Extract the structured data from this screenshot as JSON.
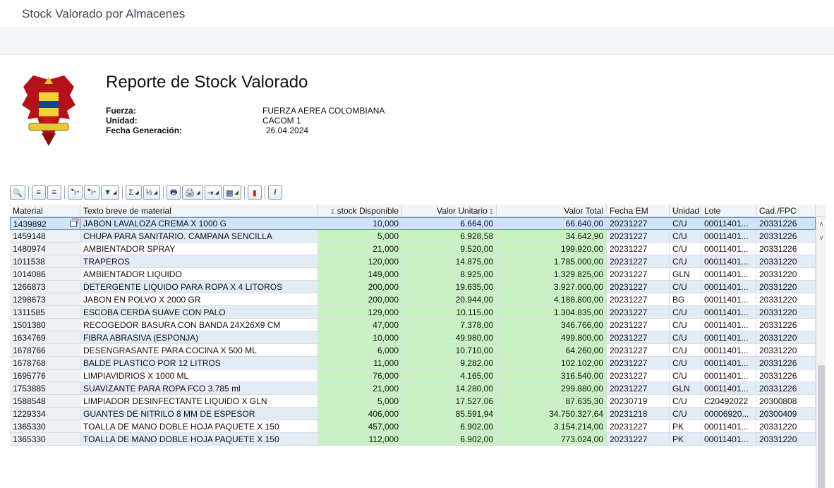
{
  "window": {
    "title": "Stock Valorado por Almacenes"
  },
  "report": {
    "title": "Reporte de Stock Valorado",
    "fields": [
      {
        "label": "Fuerza:",
        "value": "FUERZA AEREA COLOMBIANA"
      },
      {
        "label": "Unidad:",
        "value": "CACOM 1"
      },
      {
        "label": "Fecha Generación:",
        "value": "26.04.2024"
      }
    ]
  },
  "toolbar": {
    "buttons": [
      {
        "name": "details-icon",
        "glyph": "🔍"
      },
      {
        "name": "sort-ascending-icon",
        "glyph": "≡"
      },
      {
        "name": "sort-descending-icon",
        "glyph": "≡"
      },
      {
        "name": "find-icon",
        "glyph": "🔭"
      },
      {
        "name": "find-next-icon",
        "glyph": "🔭"
      },
      {
        "name": "filter-icon",
        "glyph": "▼"
      },
      {
        "name": "sum-icon",
        "glyph": "Σ"
      },
      {
        "name": "subtotal-icon",
        "glyph": "½"
      },
      {
        "name": "print-icon",
        "glyph": "🖶"
      },
      {
        "name": "print-preview-icon",
        "glyph": "🖨"
      },
      {
        "name": "export-icon",
        "glyph": "⇥"
      },
      {
        "name": "layout-icon",
        "glyph": "▦"
      },
      {
        "name": "graphic-icon",
        "glyph": "▮"
      },
      {
        "name": "info-icon",
        "glyph": "i"
      }
    ]
  },
  "table": {
    "columns": [
      "Material",
      "Texto breve de material",
      "stock Disponible",
      "Valor Unitario",
      "Valor Total",
      "Fecha EM",
      "Unidad",
      "Lote",
      "Cad./FPC"
    ],
    "sum_marker": "Σ",
    "rows": [
      [
        "1439892",
        "JABON LAVALOZA CREMA X 1000 G",
        "10,000",
        "6.664,00",
        "66.640,00",
        "20231227",
        "C/U",
        "00011401...",
        "20331226"
      ],
      [
        "1459148",
        "CHUPA  PARA SANITARIO. CAMPANA SENCILLA",
        "5,000",
        "6.928,58",
        "34.642,90",
        "20231227",
        "C/U",
        "00011401...",
        "20331226"
      ],
      [
        "1480974",
        "AMBIENTADOR SPRAY",
        "21,000",
        "9.520,00",
        "199.920,00",
        "20231227",
        "C/U",
        "00011401...",
        "20331226"
      ],
      [
        "1011538",
        "TRAPEROS",
        "120,000",
        "14.875,00",
        "1.785.000,00",
        "20231227",
        "C/U",
        "00011401...",
        "20331220"
      ],
      [
        "1014086",
        "AMBIENTADOR LIQUIDO",
        "149,000",
        "8.925,00",
        "1.329.825,00",
        "20231227",
        "GLN",
        "00011401...",
        "20331220"
      ],
      [
        "1266873",
        "DETERGENTE LIQUIDO PARA ROPA X 4 LITOROS",
        "200,000",
        "19.635,00",
        "3.927.000,00",
        "20231227",
        "C/U",
        "00011401...",
        "20331220"
      ],
      [
        "1298673",
        "JABON EN POLVO X 2000 GR",
        "200,000",
        "20.944,00",
        "4.188.800,00",
        "20231227",
        "BG",
        "00011401...",
        "20331220"
      ],
      [
        "1311585",
        "ESCOBA CERDA SUAVE CON PALO",
        "129,000",
        "10.115,00",
        "1.304.835,00",
        "20231227",
        "C/U",
        "00011401...",
        "20331220"
      ],
      [
        "1501380",
        "RECOGEDOR BASURA CON BANDA 24X26X9 CM",
        "47,000",
        "7.378,00",
        "346.766,00",
        "20231227",
        "C/U",
        "00011401...",
        "20331226"
      ],
      [
        "1634769",
        "FIBRA ABRASIVA (ESPONJA)",
        "10,000",
        "49.980,00",
        "499.800,00",
        "20231227",
        "C/U",
        "00011401...",
        "20331220"
      ],
      [
        "1678766",
        "DESENGRASANTE PARA COCINA X 500 ML",
        "6,000",
        "10.710,00",
        "64.260,00",
        "20231227",
        "C/U",
        "00011401...",
        "20331220"
      ],
      [
        "1678768",
        "BALDE PLASTICO POR 12 LITROS",
        "11,000",
        "9.282,00",
        "102.102,00",
        "20231227",
        "C/U",
        "00011401...",
        "20331226"
      ],
      [
        "1695776",
        "LIMPIAVIDRIOS X 1000 ML",
        "76,000",
        "4.165,00",
        "316.540,00",
        "20231227",
        "C/U",
        "00011401...",
        "20331226"
      ],
      [
        "1753885",
        "SUAVIZANTE PARA ROPA FCO 3.785 ml",
        "21,000",
        "14.280,00",
        "299.880,00",
        "20231227",
        "GLN",
        "00011401...",
        "20331226"
      ],
      [
        "1588548",
        "LIMPIADOR DESINFECTANTE LIQUIDO X GLN",
        "5,000",
        "17.527,06",
        "87.635,30",
        "20230719",
        "C/U",
        "C20492022",
        "20300808"
      ],
      [
        "1229334",
        "GUANTES DE NITRILO 8 MM DE ESPESOR",
        "406,000",
        "85.591,94",
        "34.750.327,64",
        "20231218",
        "C/U",
        "00006920...",
        "20300409"
      ],
      [
        "1365330",
        "TOALLA DE MANO DOBLE HOJA  PAQUETE X 150",
        "457,000",
        "6.902,00",
        "3.154.214,00",
        "20231227",
        "PK",
        "00011401...",
        "20331220"
      ],
      [
        "1365330",
        "TOALLA DE MANO DOBLE HOJA  PAQUETE X 150",
        "112,000",
        "6.902,00",
        "773.024,00",
        "20231227",
        "PK",
        "00011401...",
        "20331220"
      ]
    ]
  },
  "colors": {
    "accent": "#6a95c8",
    "num_cell": "#c9f2c2",
    "row_alt": "#e3ebf5"
  }
}
